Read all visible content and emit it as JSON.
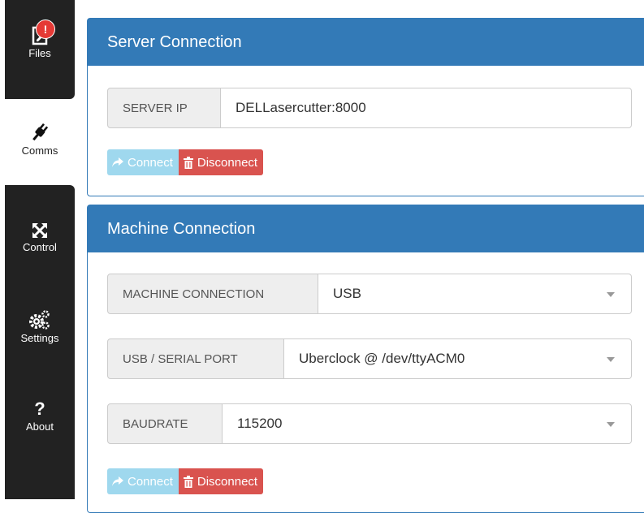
{
  "sidebar": {
    "items": [
      {
        "label": "Files",
        "icon": "file-icon",
        "badge": "!"
      },
      {
        "label": "Comms",
        "icon": "plug-icon"
      },
      {
        "label": "Control",
        "icon": "move-arrows-icon"
      },
      {
        "label": "Settings",
        "icon": "gears-icon"
      },
      {
        "label": "About",
        "icon": "question-icon",
        "glyph": "?"
      }
    ]
  },
  "server": {
    "title": "Server Connection",
    "ip_label": "SERVER IP",
    "ip_value": "DELLasercutter:8000",
    "connect_label": "Connect",
    "disconnect_label": "Disconnect"
  },
  "machine": {
    "title": "Machine Connection",
    "connection_label": "MACHINE CONNECTION",
    "connection_value": "USB",
    "port_label": "USB / SERIAL PORT",
    "port_value": "Uberclock @ /dev/ttyACM0",
    "baud_label": "BAUDRATE",
    "baud_value": "115200",
    "connect_label": "Connect",
    "disconnect_label": "Disconnect"
  },
  "colors": {
    "primary": "#337ab7",
    "connect": "#9fd8ee",
    "danger": "#d9534f",
    "sidebar": "#222222",
    "badge": "#e53935"
  }
}
